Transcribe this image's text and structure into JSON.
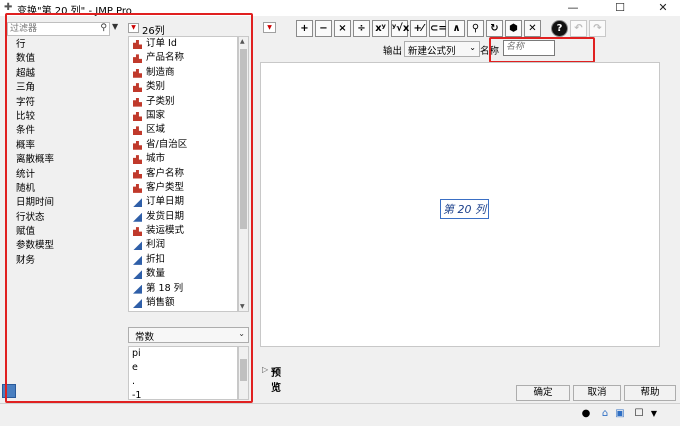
{
  "window": {
    "title": "变换\"第 20 列\" - JMP Pro",
    "min_glyph": "—",
    "max_glyph": "☐",
    "close_glyph": "✕"
  },
  "functions": {
    "filter_placeholder": "过滤器",
    "search_glyph": "⚲",
    "dropdown_glyph": "▼",
    "items": [
      "行",
      "数值",
      "超越",
      "三角",
      "字符",
      "比较",
      "条件",
      "概率",
      "离散概率",
      "统计",
      "随机",
      "日期时间",
      "行状态",
      "赋值",
      "参数模型",
      "财务"
    ]
  },
  "columns": {
    "count_label": "26列",
    "menu_glyph": "▼",
    "items": [
      {
        "name": "订单 Id",
        "kind": "bars"
      },
      {
        "name": "产品名称",
        "kind": "bars"
      },
      {
        "name": "制造商",
        "kind": "bars"
      },
      {
        "name": "类别",
        "kind": "bars"
      },
      {
        "name": "子类别",
        "kind": "bars"
      },
      {
        "name": "国家",
        "kind": "bars"
      },
      {
        "name": "区域",
        "kind": "bars"
      },
      {
        "name": "省/自治区",
        "kind": "bars"
      },
      {
        "name": "城市",
        "kind": "bars"
      },
      {
        "name": "客户名称",
        "kind": "bars"
      },
      {
        "name": "客户类型",
        "kind": "bars"
      },
      {
        "name": "订单日期",
        "kind": "tri"
      },
      {
        "name": "发货日期",
        "kind": "tri"
      },
      {
        "name": "装运模式",
        "kind": "bars"
      },
      {
        "name": "利润",
        "kind": "tri"
      },
      {
        "name": "折扣",
        "kind": "tri"
      },
      {
        "name": "数量",
        "kind": "tri"
      },
      {
        "name": "第 18 列",
        "kind": "tri"
      },
      {
        "name": "销售额",
        "kind": "tri"
      }
    ]
  },
  "constants": {
    "selected": "常数",
    "arrow": "⌄",
    "items": [
      "pi",
      "e",
      ".",
      "-1"
    ]
  },
  "toolbar": {
    "buttons": [
      "+",
      "−",
      "×",
      "÷",
      "xʸ",
      "ʸ√x",
      "+⁄−",
      "⊂=",
      "∧",
      "⚲",
      "↻",
      "⬢",
      "✕",
      "?",
      "↶",
      "↷"
    ]
  },
  "output": {
    "label": "输出",
    "selected": "新建公式列",
    "arrow": "⌄",
    "name_label": "名称",
    "name_placeholder": "名称"
  },
  "editor": {
    "formula_column": "第 20 列"
  },
  "preview": {
    "label": "预览",
    "glyph": "▷"
  },
  "buttons": {
    "ok": "确定",
    "cancel": "取消",
    "help": "帮助"
  },
  "status": {
    "info_glyph": "●",
    "home_glyph": "⌂",
    "sync_glyph": "▣",
    "box_glyph": "☐",
    "down_glyph": "▼"
  },
  "colors": {
    "highlight_frame": "#e02020",
    "nominal_icon": "#c0392b",
    "continuous_icon": "#2f5fa8"
  }
}
